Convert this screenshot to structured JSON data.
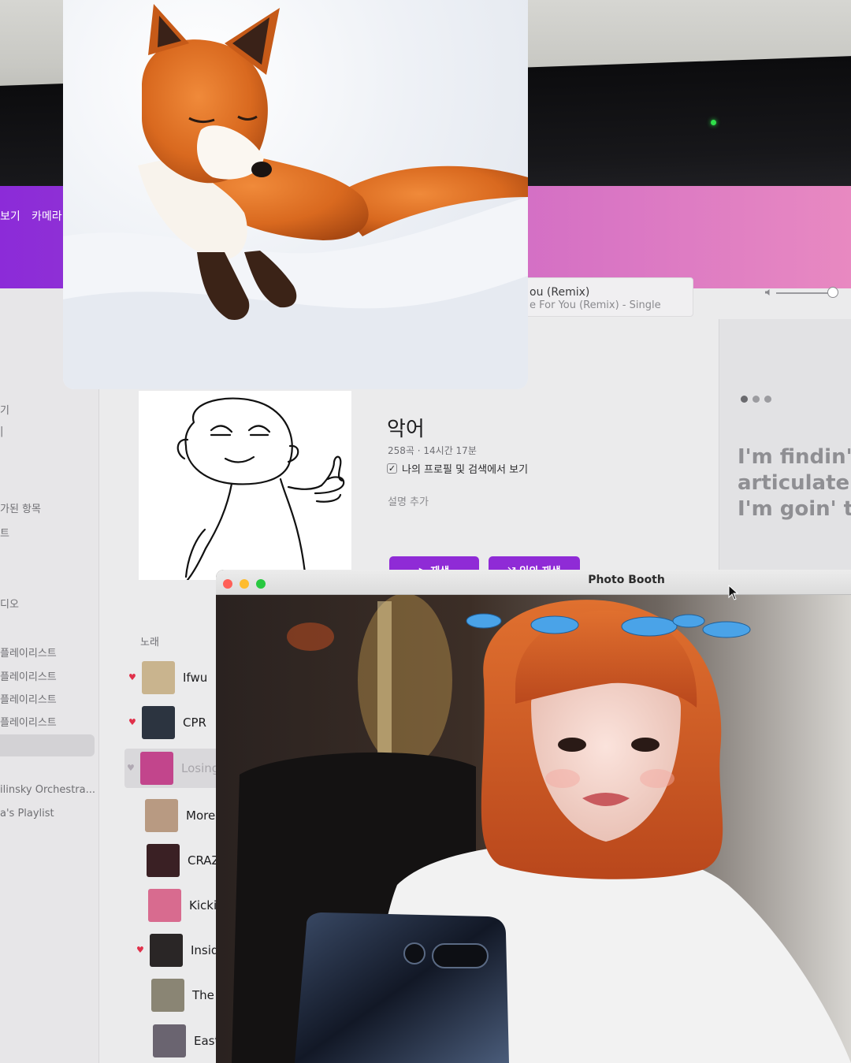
{
  "browser": {
    "tab_left": "보기",
    "tab_camera": "카메라"
  },
  "music": {
    "sidebar": {
      "items": [
        "기",
        "|",
        "가된 항목",
        "트",
        "디오",
        "플레이리스트",
        "플레이리스트",
        "플레이리스트",
        "플레이리스트",
        "ilinsky Orchestra...",
        "a's Playlist"
      ]
    },
    "now_playing": {
      "title": "ou (Remix)",
      "subtitle": "e For You (Remix) - Single"
    },
    "playlist": {
      "title": "악어",
      "meta": "258곡 · 14시간 17분",
      "profile_checkbox_label": "나의 프로필 및 검색에서 보기",
      "profile_checked": true,
      "description_placeholder": "설명 추가",
      "play_button": "▶ 재생",
      "shuffle_button": "⤨ 임의 재생"
    },
    "songs_header": "노래",
    "songs": [
      {
        "title": "Ifwu",
        "loved": true,
        "selected": false,
        "thumb_color": "#c9b48e"
      },
      {
        "title": "CPR",
        "loved": true,
        "selected": false,
        "thumb_color": "#2c3440"
      },
      {
        "title": "Losing",
        "loved": true,
        "selected": true,
        "thumb_color": "#c2458c"
      },
      {
        "title": "More T",
        "loved": false,
        "selected": false,
        "thumb_color": "#b89a82"
      },
      {
        "title": "CRAZY",
        "loved": false,
        "selected": false,
        "thumb_color": "#3a2024"
      },
      {
        "title": "Kickin",
        "loved": false,
        "selected": false,
        "thumb_color": "#d86b8f"
      },
      {
        "title": "Inside",
        "loved": true,
        "selected": false,
        "thumb_color": "#2a2626"
      },
      {
        "title": "The Dr",
        "loved": false,
        "selected": false,
        "thumb_color": "#8a8574"
      },
      {
        "title": "Eastsi",
        "loved": false,
        "selected": false,
        "thumb_color": "#6a6470"
      }
    ],
    "lyrics": [
      "I'm findin' w",
      "articulate t",
      "I'm goin' th"
    ]
  },
  "photo_booth": {
    "title": "Photo Booth"
  },
  "colors": {
    "accent_purple": "#8f2bd6",
    "heart_red": "#e0304a",
    "fox_orange": "#d9691f",
    "hair_orange": "#d8612a"
  }
}
